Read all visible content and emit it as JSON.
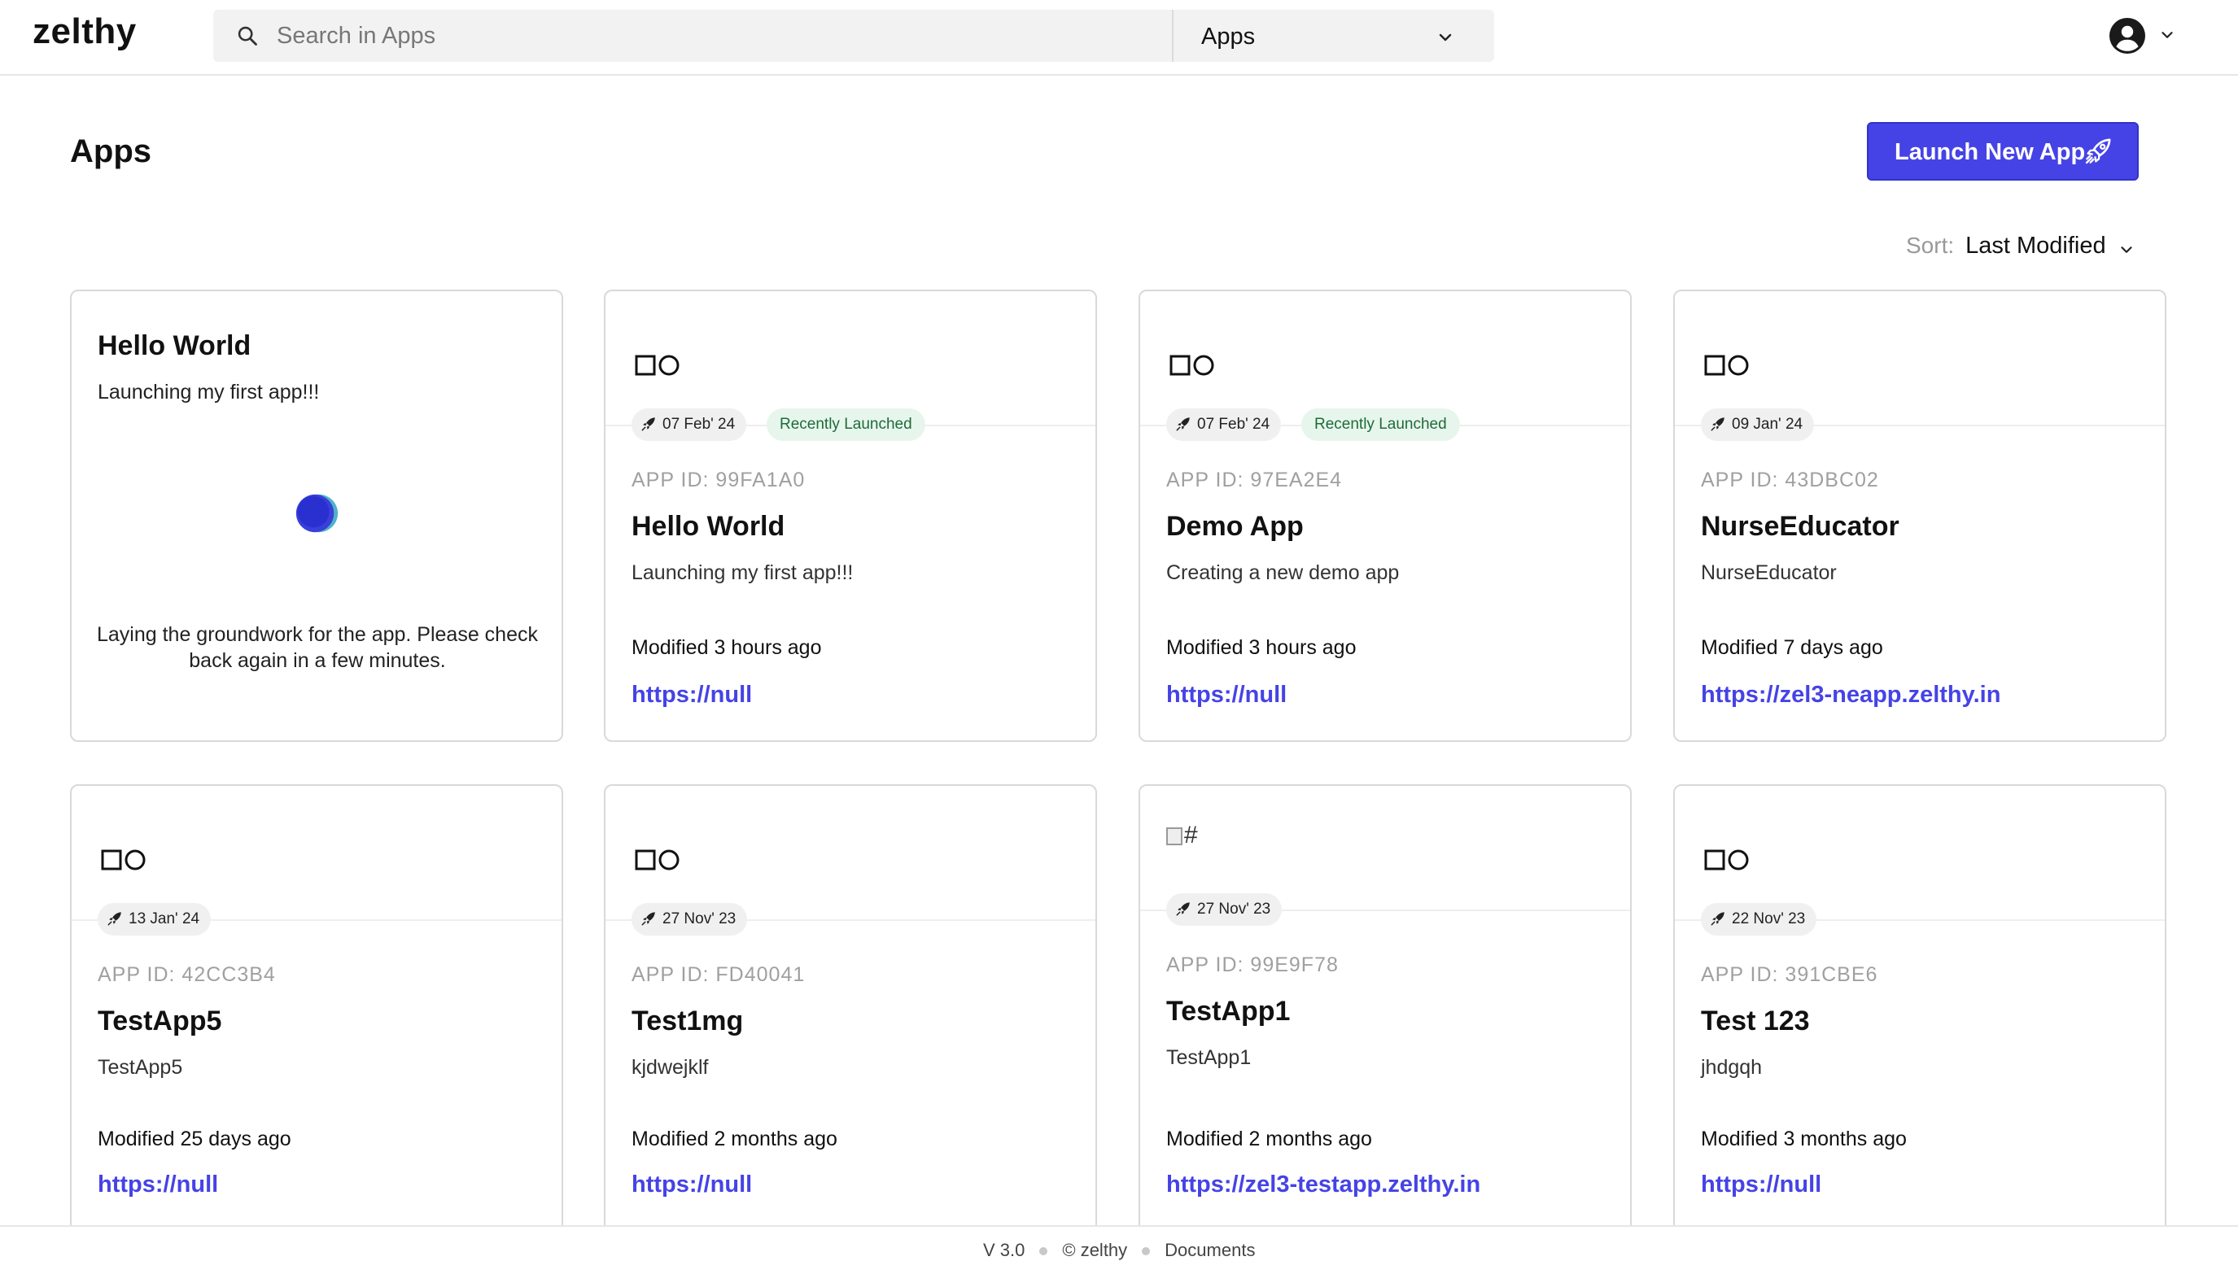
{
  "header": {
    "logo": "zelthy",
    "search": {
      "placeholder": "Search in Apps",
      "value": ""
    },
    "scope": {
      "selected": "Apps"
    }
  },
  "page": {
    "title": "Apps",
    "launch_button": "Launch New App",
    "sort": {
      "label": "Sort:",
      "value": "Last Modified"
    }
  },
  "pending_app": {
    "name": "Hello World",
    "description": "Launching my first app!!!",
    "message": "Laying the groundwork for the app. Please check back again in a few minutes."
  },
  "apps": [
    {
      "date": "07 Feb' 24",
      "badge": "Recently Launched",
      "app_id": "APP ID: 99FA1A0",
      "name": "Hello World",
      "description": "Launching my first app!!!",
      "modified": "Modified 3 hours ago",
      "url": "https://null"
    },
    {
      "date": "07 Feb' 24",
      "badge": "Recently Launched",
      "app_id": "APP ID: 97EA2E4",
      "name": "Demo App",
      "description": "Creating a new demo app",
      "modified": "Modified 3 hours ago",
      "url": "https://null"
    },
    {
      "date": "09 Jan' 24",
      "badge": "",
      "app_id": "APP ID: 43DBC02",
      "name": "NurseEducator",
      "description": "NurseEducator",
      "modified": "Modified 7 days ago",
      "url": "https://zel3-neapp.zelthy.in"
    },
    {
      "date": "13 Jan' 24",
      "badge": "",
      "app_id": "APP ID: 42CC3B4",
      "name": "TestApp5",
      "description": "TestApp5",
      "modified": "Modified 25 days ago",
      "url": "https://null"
    },
    {
      "date": "27 Nov' 23",
      "badge": "",
      "app_id": "APP ID: FD40041",
      "name": "Test1mg",
      "description": "kjdwejklf",
      "modified": "Modified 2 months ago",
      "url": "https://null"
    },
    {
      "date": "27 Nov' 23",
      "badge": "",
      "app_id": "APP ID: 99E9F78",
      "name": "TestApp1",
      "description": "TestApp1",
      "modified": "Modified 2 months ago",
      "url": "https://zel3-testapp.zelthy.in",
      "broken_image_alt": "#"
    },
    {
      "date": "22 Nov' 23",
      "badge": "",
      "app_id": "APP ID: 391CBE6",
      "name": "Test 123",
      "description": "jhdgqh",
      "modified": "Modified 3 months ago",
      "url": "https://null"
    }
  ],
  "footer": {
    "version": "V 3.0",
    "copyright": "© zelthy",
    "documents": "Documents"
  },
  "colors": {
    "accent": "#4543e6",
    "badge_bg": "#e7f6ec",
    "badge_text": "#1f6b3a",
    "chip_bg": "#f0f0f0"
  }
}
